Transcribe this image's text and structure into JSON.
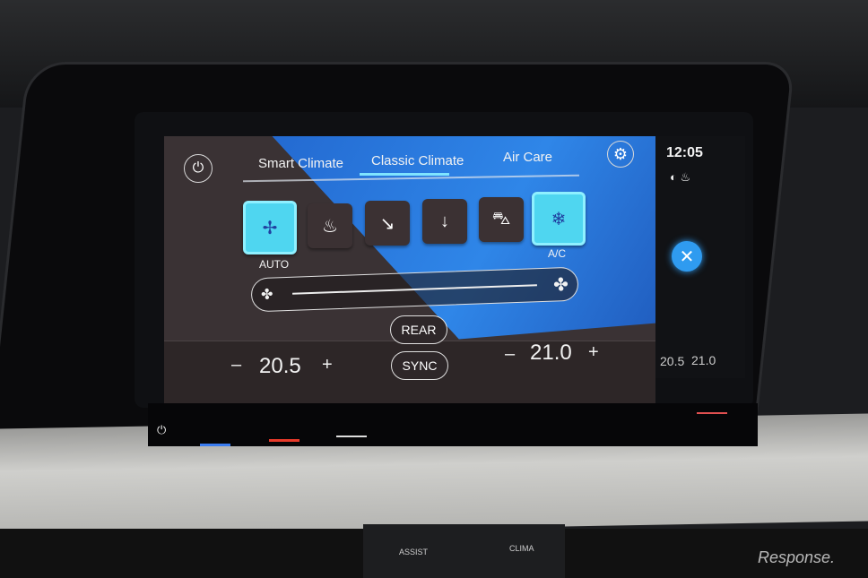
{
  "tabs": [
    {
      "label": "Smart Climate"
    },
    {
      "label": "Classic Climate",
      "active": true
    },
    {
      "label": "Air Care"
    }
  ],
  "status": {
    "time": "12:05",
    "left_temp_small": "20.5",
    "right_temp_small": "21.0"
  },
  "icons": {
    "power": "power-icon",
    "settings": "gear-icon",
    "close": "close-icon"
  },
  "modes": [
    {
      "name": "auto",
      "label": "AUTO",
      "icon": "fan-icon",
      "active": true
    },
    {
      "name": "windshield-defrost",
      "icon": "windshield-defrost-icon",
      "active": false
    },
    {
      "name": "airflow-upper",
      "icon": "airflow-upper-body-icon",
      "active": false
    },
    {
      "name": "airflow-footwell",
      "icon": "airflow-footwell-icon",
      "active": false
    },
    {
      "name": "recirculation",
      "icon": "car-recirculation-icon",
      "active": false
    },
    {
      "name": "ac",
      "label": "A/C",
      "icon": "snowflake-icon",
      "active": true
    }
  ],
  "fan": {
    "level_percent": 100
  },
  "left_zone": {
    "minus": "–",
    "temp": "20.5",
    "plus": "+"
  },
  "right_zone": {
    "minus": "–",
    "temp": "21.0",
    "plus": "+"
  },
  "rear_label": "REAR",
  "sync_label": "SYNC",
  "console": {
    "assist_label": "ASSIST",
    "clima_label": "CLIMA",
    "watermark": "Response."
  },
  "colors": {
    "accent": "#4fd6f0",
    "blue_bg": "#2f86e8",
    "close_button": "#2f9bf0"
  }
}
